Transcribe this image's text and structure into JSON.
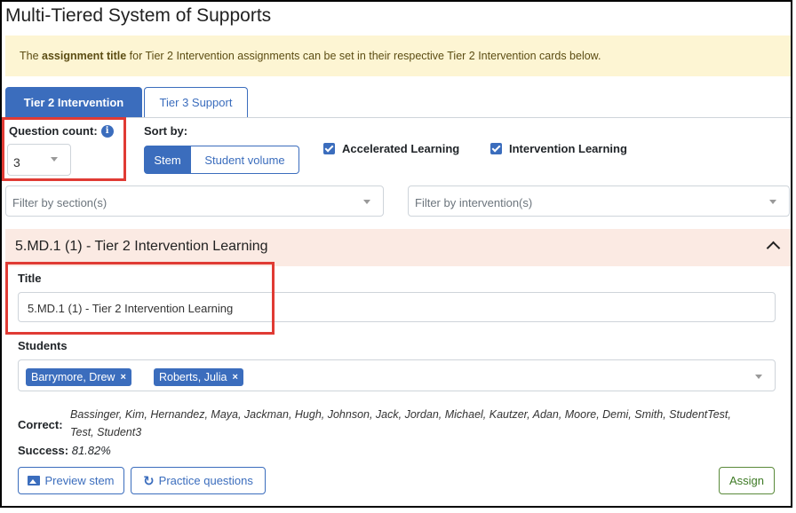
{
  "page": {
    "title": "Multi-Tiered System of Supports"
  },
  "banner": {
    "prefix": "The ",
    "bold": "assignment title",
    "suffix": " for Tier 2 Intervention assignments can be set in their respective Tier 2 Intervention cards below."
  },
  "tabs": [
    {
      "label": "Tier 2 Intervention",
      "active": true
    },
    {
      "label": "Tier 3 Support",
      "active": false
    }
  ],
  "question_count": {
    "label": "Question count:",
    "value": "3",
    "info_icon": "info-icon"
  },
  "sort": {
    "label": "Sort by:",
    "options": [
      "Stem",
      "Student volume"
    ],
    "selected": "Stem"
  },
  "checkboxes": [
    {
      "label": "Accelerated Learning",
      "checked": true
    },
    {
      "label": "Intervention Learning",
      "checked": true
    }
  ],
  "filters": {
    "section_placeholder": "Filter by section(s)",
    "intervention_placeholder": "Filter by intervention(s)"
  },
  "card": {
    "header": "5.MD.1 (1) - Tier 2 Intervention Learning",
    "title_label": "Title",
    "title_value": "5.MD.1 (1) - Tier 2 Intervention Learning",
    "students_label": "Students",
    "students": [
      "Barrymore, Drew",
      "Roberts, Julia"
    ],
    "correct_label": "Correct:",
    "correct_text": "Bassinger, Kim, Hernandez, Maya, Jackman, Hugh, Johnson, Jack, Jordan, Michael, Kautzer, Adan, Moore, Demi, Smith, StudentTest, Test, Student3",
    "success_label": "Success:",
    "success_value": "81.82%",
    "buttons": {
      "preview": "Preview stem",
      "practice": "Practice questions",
      "assign": "Assign"
    }
  },
  "colors": {
    "primary": "#3b6dbd",
    "banner_bg": "#fdf5d3",
    "card_header_bg": "#fbeae3",
    "highlight_red": "#e03b34",
    "assign_green": "#3d7a24"
  }
}
